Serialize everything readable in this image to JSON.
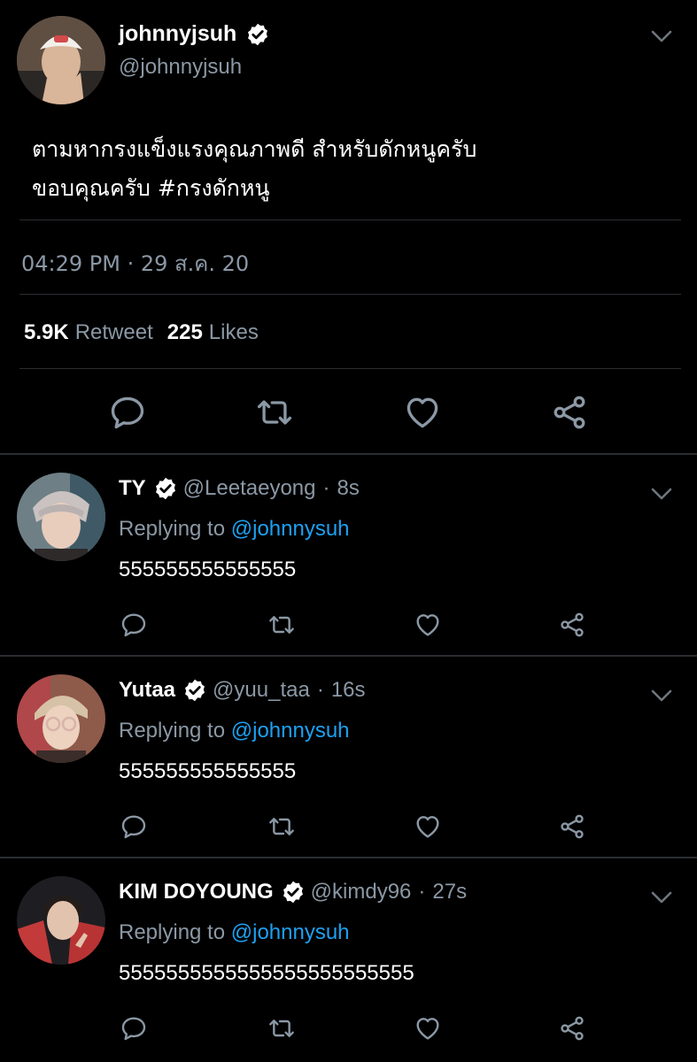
{
  "main_tweet": {
    "name": "johnnyjsuh",
    "handle": "@johnnyjsuh",
    "text_line1": "ตามหากรงแข็งแรงคุณภาพดี สำหรับดักหนูครับ",
    "text_line2": "ขอบคุณครับ #กรงดักหนู",
    "timestamp": "04:29 PM · 29 ส.ค. 20",
    "retweet_count": "5.9K",
    "retweet_label": "Retweet",
    "like_count": "225",
    "like_label": "Likes"
  },
  "replies": [
    {
      "name": "TY",
      "handle": "@Leetaeyong",
      "dot": "·",
      "time": "8s",
      "replying_prefix": "Replying to",
      "replying_to": "@johnnysuh",
      "text": "555555555555555"
    },
    {
      "name": "Yutaa",
      "handle": "@yuu_taa",
      "dot": "·",
      "time": "16s",
      "replying_prefix": "Replying to",
      "replying_to": "@johnnysuh",
      "text": "555555555555555"
    },
    {
      "name": "KIM DOYOUNG",
      "handle": "@kimdy96",
      "dot": "·",
      "time": "27s",
      "replying_prefix": "Replying to",
      "replying_to": "@johnnysuh",
      "text": "5555555555555555555555555"
    }
  ],
  "icons": {
    "verified": "verified-badge-icon",
    "caret": "chevron-down-icon",
    "reply": "reply-bubble-icon",
    "retweet": "retweet-icon",
    "like": "heart-icon",
    "share": "share-icon"
  },
  "colors": {
    "background": "#000000",
    "secondary_text": "#8b98a5",
    "mention": "#1da1f2",
    "divider": "#2a2d31"
  }
}
